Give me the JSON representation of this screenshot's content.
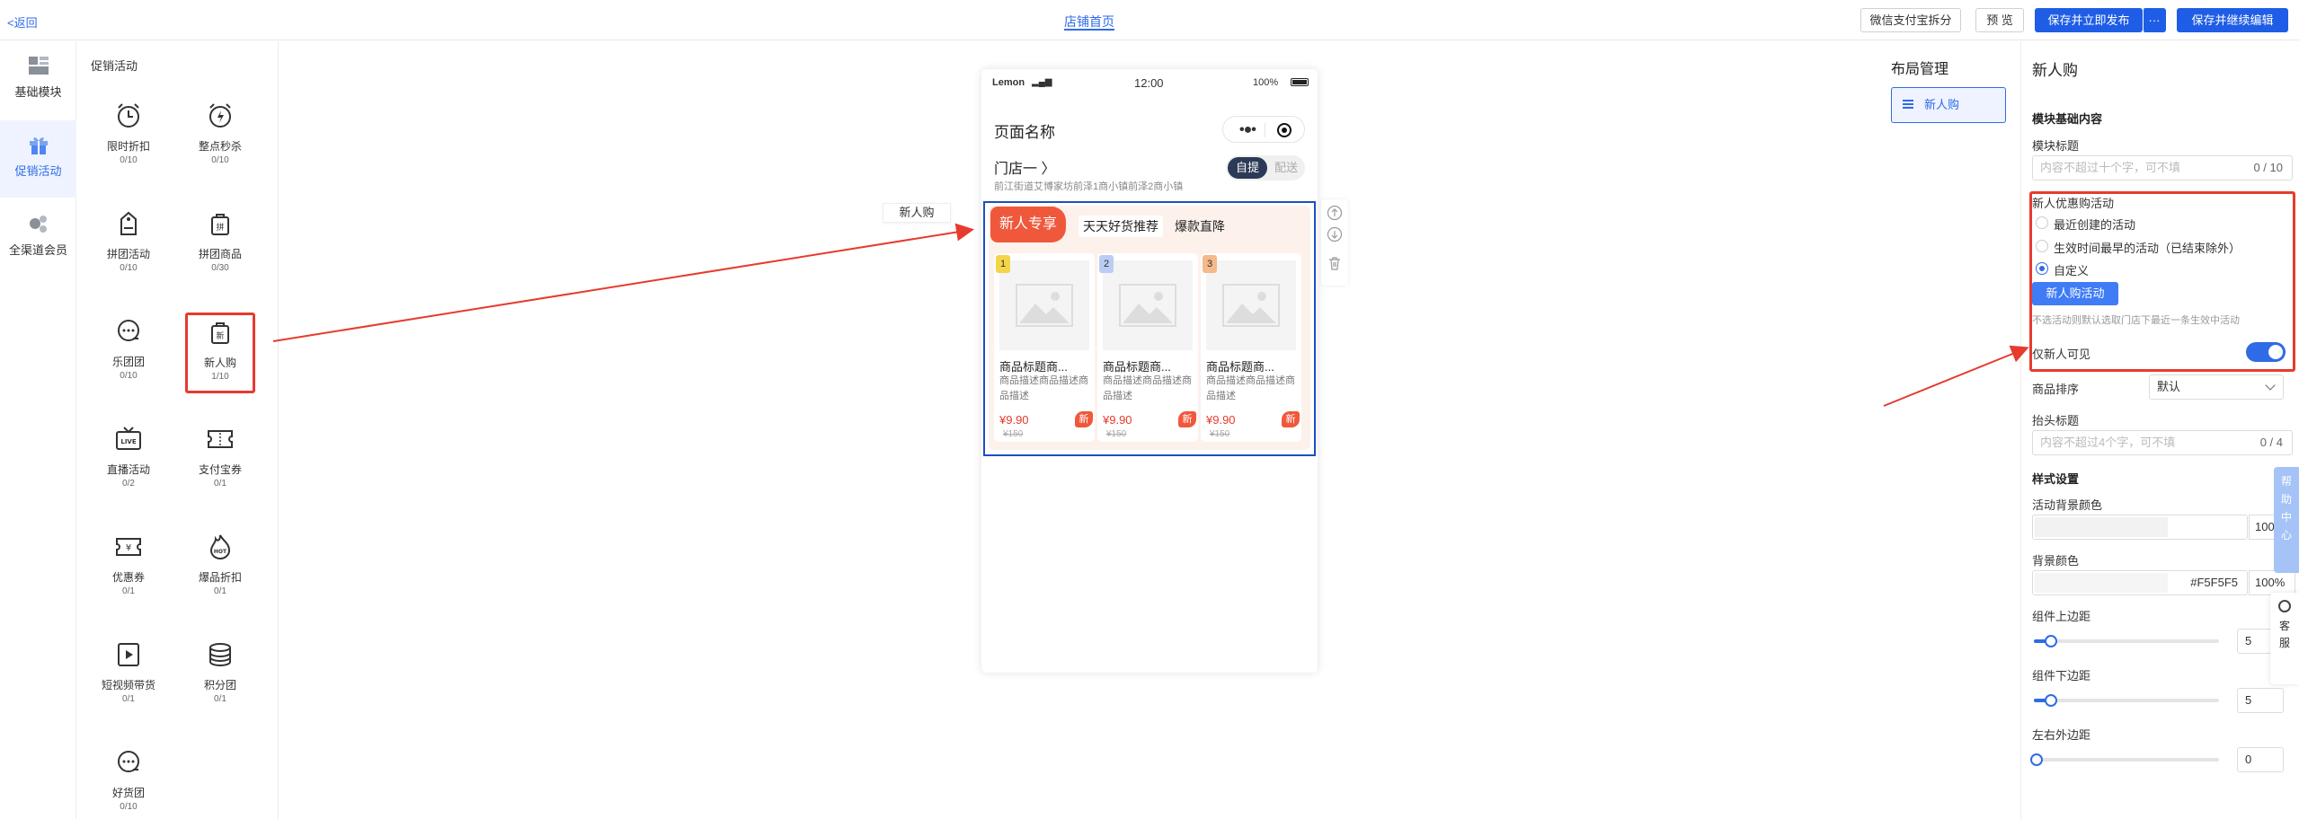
{
  "topbar": {
    "back": "<返回",
    "title": "店铺首页",
    "buttons": {
      "split": "微信支付宝拆分",
      "preview": "预 览",
      "save_publish": "保存并立即发布",
      "more": "···",
      "save_continue": "保存并继续编辑"
    }
  },
  "categories": [
    {
      "label": "基础模块",
      "icon": "grid-icon"
    },
    {
      "label": "促销活动",
      "icon": "gift-icon"
    },
    {
      "label": "全渠道会员",
      "icon": "members-icon"
    }
  ],
  "components": {
    "title": "促销活动",
    "items": [
      {
        "name": "限时折扣",
        "count": "0/10"
      },
      {
        "name": "整点秒杀",
        "count": "0/10"
      },
      {
        "name": "拼团活动",
        "count": "0/10"
      },
      {
        "name": "拼团商品",
        "count": "0/30"
      },
      {
        "name": "乐团团",
        "count": "0/10"
      },
      {
        "name": "新人购",
        "count": "1/10"
      },
      {
        "name": "直播活动",
        "count": "0/2"
      },
      {
        "name": "支付宝券",
        "count": "0/1"
      },
      {
        "name": "优惠券",
        "count": "0/1"
      },
      {
        "name": "爆品折扣",
        "count": "0/1"
      },
      {
        "name": "短视频带货",
        "count": "0/1"
      },
      {
        "name": "积分团",
        "count": "0/1"
      },
      {
        "name": "好货团",
        "count": "0/10"
      }
    ]
  },
  "canvas": {
    "chip": "新人购",
    "phone": {
      "carrier": "Lemon",
      "time": "12:00",
      "battery": "100%",
      "page_title": "页面名称",
      "store_name": "门店一 〉",
      "address": "前江街道艾博家坊前泽1商小镇前泽2商小镇",
      "toggle": {
        "pickup": "自提",
        "delivery": "配送"
      },
      "module": {
        "header": "新人专享",
        "tab1": "天天好货推荐",
        "tab2": "爆款直降",
        "products": [
          {
            "rank": "1",
            "rank_color": "#f5d548",
            "title": "商品标题商...",
            "desc": "商品描述商品描述商品描述",
            "price": "¥9.90",
            "orig": "¥150",
            "badge": "新"
          },
          {
            "rank": "2",
            "rank_color": "#b9cdf5",
            "title": "商品标题商...",
            "desc": "商品描述商品描述商品描述",
            "price": "¥9.90",
            "orig": "¥150",
            "badge": "新"
          },
          {
            "rank": "3",
            "rank_color": "#f5b98a",
            "title": "商品标题商...",
            "desc": "商品描述商品描述商品描述",
            "price": "¥9.90",
            "orig": "¥150",
            "badge": "新"
          }
        ]
      }
    }
  },
  "layout_manager": {
    "title": "布局管理",
    "item": "新人购"
  },
  "settings": {
    "title": "新人购",
    "basic_section": "模块基础内容",
    "module_title_label": "模块标题",
    "module_title_placeholder": "内容不超过十个字，可不填",
    "module_title_count": "0 / 10",
    "activity_label": "新人优惠购活动",
    "radios": [
      {
        "label": "最近创建的活动",
        "checked": false
      },
      {
        "label": "生效时间最早的活动（已结束除外）",
        "checked": false
      },
      {
        "label": "自定义",
        "checked": true
      }
    ],
    "activity_button": "新人购活动",
    "hint": "不选活动则默认选取门店下最近一条生效中活动",
    "only_new_label": "仅新人可见",
    "only_new_enabled": true,
    "sort_label": "商品排序",
    "sort_value": "默认",
    "header_title_label": "抬头标题",
    "header_title_placeholder": "内容不超过4个字，可不填",
    "header_title_count": "0 / 4",
    "style_section": "样式设置",
    "activity_bg_label": "活动背景颜色",
    "activity_bg_pct": "100%",
    "bg_label": "背景颜色",
    "bg_hex": "#F5F5F5",
    "bg_pct": "100%",
    "top_margin_label": "组件上边距",
    "top_margin_value": "5",
    "bottom_margin_label": "组件下边距",
    "bottom_margin_value": "5",
    "side_margin_label": "左右外边距",
    "side_margin_value": "0"
  },
  "floating": {
    "help": "帮助中心",
    "service": "客服"
  },
  "colors": {
    "accent": "#2f6be6",
    "highlight": "#e63b2e",
    "module_header": "#f0583c"
  }
}
